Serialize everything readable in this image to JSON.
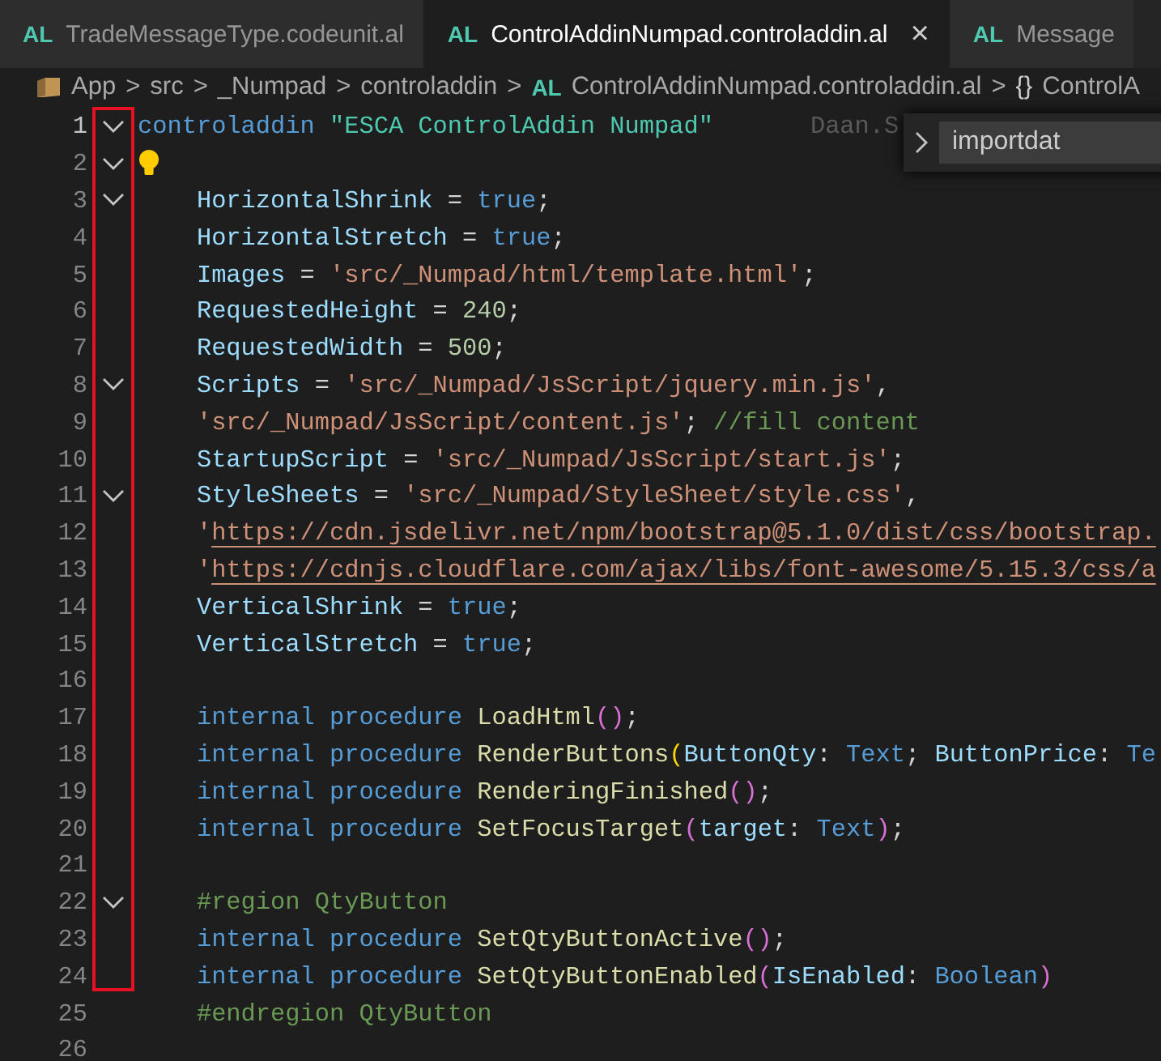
{
  "tabs": [
    {
      "icon_label": "AL",
      "label": "TradeMessageType.codeunit.al",
      "selected": false,
      "closable": false
    },
    {
      "icon_label": "AL",
      "label": "ControlAddinNumpad.controladdin.al",
      "selected": true,
      "closable": true,
      "close_label": "×"
    },
    {
      "icon_label": "AL",
      "label": "Message",
      "selected": false,
      "closable": false
    }
  ],
  "breadcrumb": [
    {
      "kind": "folder",
      "label": "App"
    },
    {
      "kind": "plain",
      "label": "src"
    },
    {
      "kind": "plain",
      "label": "_Numpad"
    },
    {
      "kind": "plain",
      "label": "controladdin"
    },
    {
      "kind": "file",
      "icon_label": "AL",
      "label": "ControlAddinNumpad.controladdin.al"
    },
    {
      "kind": "symbol",
      "icon_label": "{}",
      "label": "ControlA"
    }
  ],
  "separator": ">",
  "find_widget": {
    "value": "importdat"
  },
  "lines": [
    {
      "number": "1",
      "fold": true,
      "current": true,
      "blame": "Daan.S",
      "tokens": [
        {
          "kind": "kw",
          "text": "controladdin "
        },
        {
          "kind": "name",
          "text": "\"ESCA ControlAddin Numpad\""
        }
      ]
    },
    {
      "number": "2",
      "fold": true,
      "current": false,
      "lightbulb": true
    },
    {
      "number": "3",
      "fold": true,
      "current": false,
      "tokens": [
        {
          "kind": "prop",
          "text": "    HorizontalShrink"
        },
        {
          "kind": "punct",
          "text": " = "
        },
        {
          "kind": "kw",
          "text": "true"
        },
        {
          "kind": "punct",
          "text": ";"
        }
      ]
    },
    {
      "number": "4",
      "fold": false,
      "current": false,
      "tokens": [
        {
          "kind": "prop",
          "text": "    HorizontalStretch"
        },
        {
          "kind": "punct",
          "text": " = "
        },
        {
          "kind": "kw",
          "text": "true"
        },
        {
          "kind": "punct",
          "text": ";"
        }
      ]
    },
    {
      "number": "5",
      "fold": false,
      "current": false,
      "tokens": [
        {
          "kind": "prop",
          "text": "    Images"
        },
        {
          "kind": "punct",
          "text": " = "
        },
        {
          "kind": "str",
          "text": "'src/_Numpad/html/template.html'"
        },
        {
          "kind": "punct",
          "text": ";"
        }
      ]
    },
    {
      "number": "6",
      "fold": false,
      "current": false,
      "tokens": [
        {
          "kind": "prop",
          "text": "    RequestedHeight"
        },
        {
          "kind": "punct",
          "text": " = "
        },
        {
          "kind": "num",
          "text": "240"
        },
        {
          "kind": "punct",
          "text": ";"
        }
      ]
    },
    {
      "number": "7",
      "fold": false,
      "current": false,
      "tokens": [
        {
          "kind": "prop",
          "text": "    RequestedWidth"
        },
        {
          "kind": "punct",
          "text": " = "
        },
        {
          "kind": "num",
          "text": "500"
        },
        {
          "kind": "punct",
          "text": ";"
        }
      ]
    },
    {
      "number": "8",
      "fold": true,
      "current": false,
      "tokens": [
        {
          "kind": "prop",
          "text": "    Scripts"
        },
        {
          "kind": "punct",
          "text": " = "
        },
        {
          "kind": "str",
          "text": "'src/_Numpad/JsScript/jquery.min.js'"
        },
        {
          "kind": "punct",
          "text": ","
        }
      ]
    },
    {
      "number": "9",
      "fold": false,
      "current": false,
      "tokens": [
        {
          "kind": "str",
          "text": "    'src/_Numpad/JsScript/content.js'"
        },
        {
          "kind": "punct",
          "text": "; "
        },
        {
          "kind": "comment",
          "text": "//fill content"
        }
      ]
    },
    {
      "number": "10",
      "fold": false,
      "current": false,
      "tokens": [
        {
          "kind": "prop",
          "text": "    StartupScript"
        },
        {
          "kind": "punct",
          "text": " = "
        },
        {
          "kind": "str",
          "text": "'src/_Numpad/JsScript/start.js'"
        },
        {
          "kind": "punct",
          "text": ";"
        }
      ]
    },
    {
      "number": "11",
      "fold": true,
      "current": false,
      "tokens": [
        {
          "kind": "prop",
          "text": "    StyleSheets"
        },
        {
          "kind": "punct",
          "text": " = "
        },
        {
          "kind": "str",
          "text": "'src/_Numpad/StyleSheet/style.css'"
        },
        {
          "kind": "punct",
          "text": ","
        }
      ]
    },
    {
      "number": "12",
      "fold": false,
      "current": false,
      "tokens": [
        {
          "kind": "str",
          "text": "    '"
        },
        {
          "kind": "link",
          "text": "https://cdn.jsdelivr.net/npm/bootstrap@5.1.0/dist/css/bootstrap."
        }
      ]
    },
    {
      "number": "13",
      "fold": false,
      "current": false,
      "tokens": [
        {
          "kind": "str",
          "text": "    '"
        },
        {
          "kind": "link",
          "text": "https://cdnjs.cloudflare.com/ajax/libs/font-awesome/5.15.3/css/a"
        }
      ]
    },
    {
      "number": "14",
      "fold": false,
      "current": false,
      "tokens": [
        {
          "kind": "prop",
          "text": "    VerticalShrink"
        },
        {
          "kind": "punct",
          "text": " = "
        },
        {
          "kind": "kw",
          "text": "true"
        },
        {
          "kind": "punct",
          "text": ";"
        }
      ]
    },
    {
      "number": "15",
      "fold": false,
      "current": false,
      "tokens": [
        {
          "kind": "prop",
          "text": "    VerticalStretch"
        },
        {
          "kind": "punct",
          "text": " = "
        },
        {
          "kind": "kw",
          "text": "true"
        },
        {
          "kind": "punct",
          "text": ";"
        }
      ]
    },
    {
      "number": "16",
      "fold": false,
      "current": false
    },
    {
      "number": "17",
      "fold": false,
      "current": false,
      "tokens": [
        {
          "kind": "kw",
          "text": "    internal procedure "
        },
        {
          "kind": "fn",
          "text": "LoadHtml"
        },
        {
          "kind": "paren",
          "text": "()"
        },
        {
          "kind": "punct",
          "text": ";"
        }
      ]
    },
    {
      "number": "18",
      "fold": false,
      "current": false,
      "tokens": [
        {
          "kind": "kw",
          "text": "    internal procedure "
        },
        {
          "kind": "fn",
          "text": "RenderButtons"
        },
        {
          "kind": "paren2",
          "text": "("
        },
        {
          "kind": "prop",
          "text": "ButtonQty"
        },
        {
          "kind": "punct",
          "text": ": "
        },
        {
          "kind": "kw",
          "text": "Text"
        },
        {
          "kind": "punct",
          "text": "; "
        },
        {
          "kind": "prop",
          "text": "ButtonPrice"
        },
        {
          "kind": "punct",
          "text": ": "
        },
        {
          "kind": "kw",
          "text": "Te"
        }
      ]
    },
    {
      "number": "19",
      "fold": false,
      "current": false,
      "tokens": [
        {
          "kind": "kw",
          "text": "    internal procedure "
        },
        {
          "kind": "fn",
          "text": "RenderingFinished"
        },
        {
          "kind": "paren",
          "text": "()"
        },
        {
          "kind": "punct",
          "text": ";"
        }
      ]
    },
    {
      "number": "20",
      "fold": false,
      "current": false,
      "tokens": [
        {
          "kind": "kw",
          "text": "    internal procedure "
        },
        {
          "kind": "fn",
          "text": "SetFocusTarget"
        },
        {
          "kind": "paren",
          "text": "("
        },
        {
          "kind": "prop",
          "text": "target"
        },
        {
          "kind": "punct",
          "text": ": "
        },
        {
          "kind": "kw",
          "text": "Text"
        },
        {
          "kind": "paren",
          "text": ")"
        },
        {
          "kind": "punct",
          "text": ";"
        }
      ]
    },
    {
      "number": "21",
      "fold": false,
      "current": false
    },
    {
      "number": "22",
      "fold": true,
      "current": false,
      "tokens": [
        {
          "kind": "comment",
          "text": "    #region QtyButton"
        }
      ]
    },
    {
      "number": "23",
      "fold": false,
      "current": false,
      "tokens": [
        {
          "kind": "kw",
          "text": "    internal procedure "
        },
        {
          "kind": "fn",
          "text": "SetQtyButtonActive"
        },
        {
          "kind": "paren",
          "text": "()"
        },
        {
          "kind": "punct",
          "text": ";"
        }
      ]
    },
    {
      "number": "24",
      "fold": false,
      "current": false,
      "tokens": [
        {
          "kind": "kw",
          "text": "    internal procedure "
        },
        {
          "kind": "fn",
          "text": "SetQtyButtonEnabled"
        },
        {
          "kind": "paren",
          "text": "("
        },
        {
          "kind": "prop",
          "text": "IsEnabled"
        },
        {
          "kind": "punct",
          "text": ": "
        },
        {
          "kind": "kw",
          "text": "Boolean"
        },
        {
          "kind": "paren",
          "text": ")"
        }
      ]
    },
    {
      "number": "25",
      "fold": false,
      "current": false,
      "tokens": [
        {
          "kind": "comment",
          "text": "    #endregion QtyButton"
        }
      ]
    },
    {
      "number": "26",
      "fold": false,
      "current": false
    }
  ]
}
